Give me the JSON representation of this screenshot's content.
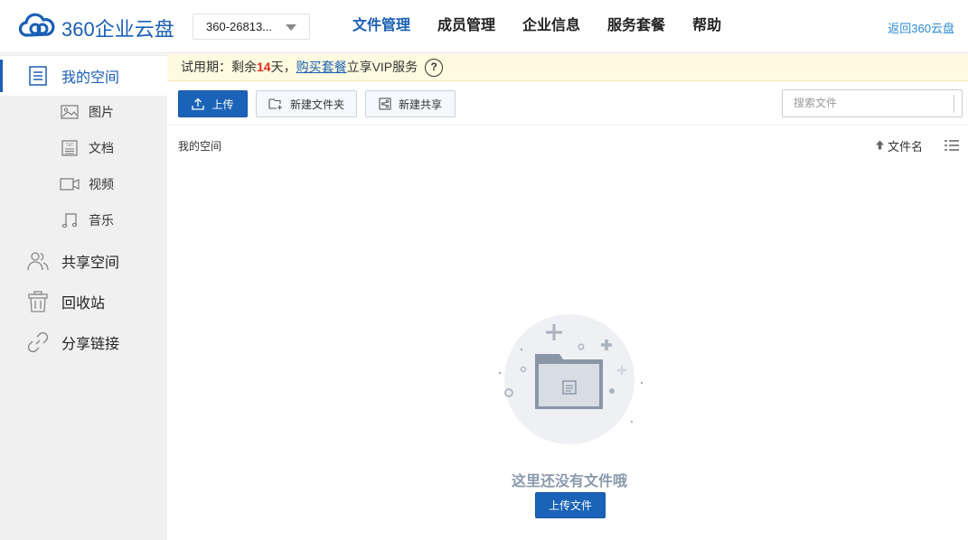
{
  "header": {
    "logo_text": "360企业云盘",
    "account": "360-26813...",
    "nav": [
      {
        "label": "文件管理",
        "active": true
      },
      {
        "label": "成员管理",
        "active": false
      },
      {
        "label": "企业信息",
        "active": false
      },
      {
        "label": "服务套餐",
        "active": false
      },
      {
        "label": "帮助",
        "active": false
      }
    ],
    "back_link": "返回360云盘"
  },
  "sidebar": {
    "my_space": "我的空间",
    "sub_items": [
      "图片",
      "文档",
      "视频",
      "音乐"
    ],
    "shared_space": "共享空间",
    "recycle_bin": "回收站",
    "share_links": "分享链接"
  },
  "banner": {
    "prefix": "试用期：剩余",
    "days": "14",
    "suffix": "天，",
    "buy_link": "购买套餐",
    "tail": "立享VIP服务",
    "help": "?"
  },
  "toolbar": {
    "upload": "上传",
    "new_folder": "新建文件夹",
    "new_share": "新建共享",
    "search_placeholder": "搜索文件"
  },
  "content": {
    "breadcrumb": "我的空间",
    "sort_label": "文件名",
    "empty_text": "这里还没有文件哦",
    "empty_upload": "上传文件"
  },
  "colors": {
    "brand": "#1a5fb4",
    "primary_button": "#1a63b8",
    "trial_days": "#e0301e",
    "banner_bg": "#fffbe0",
    "sidebar_bg": "#f0f0f0"
  }
}
